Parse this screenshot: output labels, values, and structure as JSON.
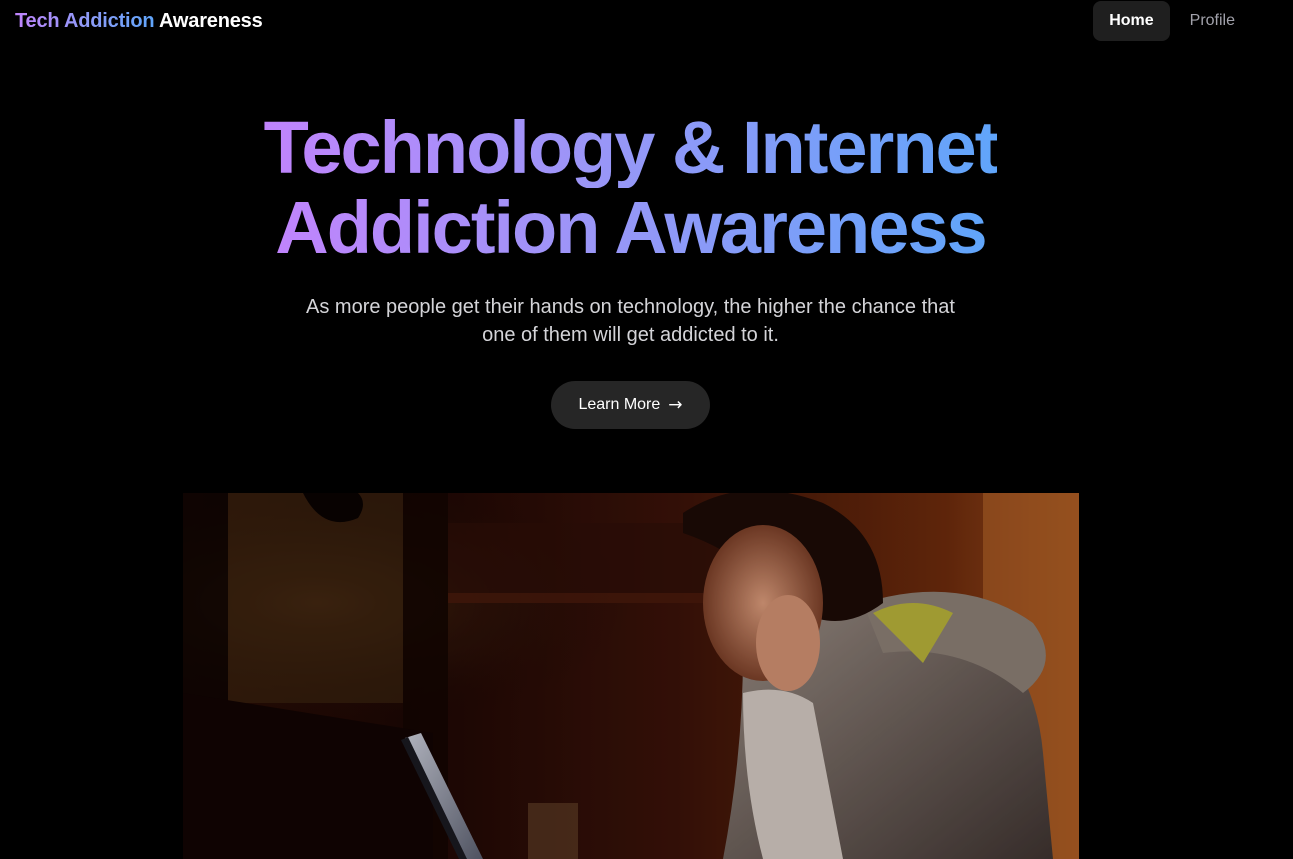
{
  "header": {
    "brand_accent": "Tech Addiction",
    "brand_main": "Awareness",
    "nav": [
      {
        "label": "Home",
        "active": true
      },
      {
        "label": "Profile",
        "active": false
      }
    ]
  },
  "hero": {
    "title_line1": "Technology & Internet",
    "title_line2": "Addiction Awareness",
    "subtitle": "As more people get their hands on technology, the higher the chance that one of them will get addicted to it.",
    "cta_label": "Learn More",
    "cta_icon": "arrow-right-icon"
  },
  "image": {
    "subject": "woman-using-laptop-in-dark-room",
    "accent_colors": [
      "#c084fc",
      "#60a5fa"
    ],
    "background": "#000000"
  }
}
